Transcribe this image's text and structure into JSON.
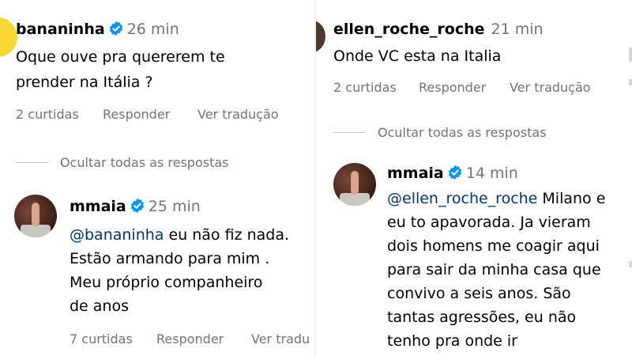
{
  "left": {
    "comment": {
      "username": "bananinha",
      "time": "26 min",
      "text_line1": "Oque ouve pra quererem te",
      "text_line2": "prender na Itália ?",
      "likes": "2 curtidas",
      "reply": "Responder",
      "translate": "Ver tradução"
    },
    "hide_replies": "Ocultar todas as respostas",
    "reply": {
      "username": "mmaia",
      "time": "25 min",
      "mention": "@bananinha",
      "line1_rest": " eu não fiz nada.",
      "line2": "Estão armando para mim .",
      "line3": "Meu próprio companheiro",
      "line4": "de anos",
      "likes": "7 curtidas",
      "reply": "Responder",
      "translate": "Ver tradu"
    }
  },
  "right": {
    "comment": {
      "username": "ellen_roche_roche",
      "time": "21 min",
      "text_line1": "Onde VC esta na Italia",
      "likes": "2 curtidas",
      "reply": "Responder",
      "translate": "Ver tradução"
    },
    "hide_replies": "Ocultar todas as respostas",
    "reply": {
      "username": "mmaia",
      "time": "14 min",
      "mention": "@ellen_roche_roche",
      "line1_rest": " Milano e",
      "line2": "eu to apavorada. Ja vieram",
      "line3": "dois homens me coagir aqui",
      "line4": "para sair da minha casa que",
      "line5": "convivo a seis anos. São",
      "line6": "tantas agressões, eu não",
      "line7": "tenho pra onde ir"
    }
  },
  "colors": {
    "verified": "#0095f6",
    "mention": "#00376b",
    "secondary_text": "#737373"
  },
  "icons": {
    "verified": "verified-badge-icon"
  }
}
